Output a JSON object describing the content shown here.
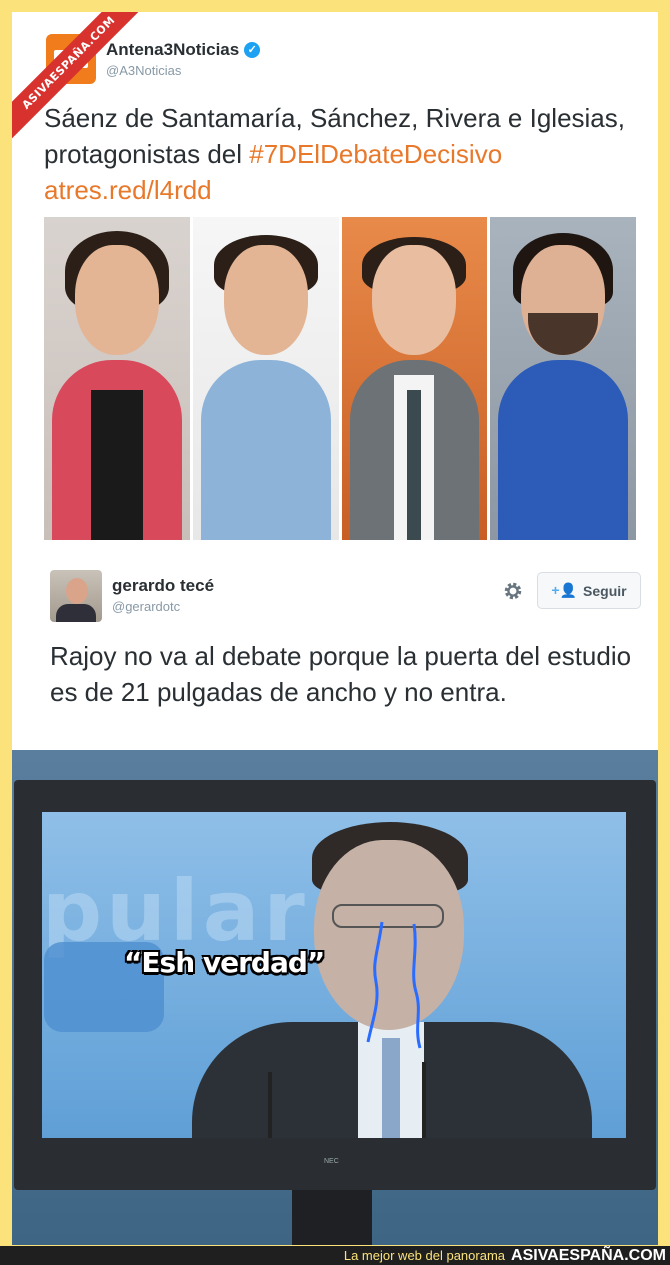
{
  "watermark": {
    "ribbon": "ASIVAESPAÑA.COM"
  },
  "tweet1": {
    "avatar_logo": "3n",
    "display_name": "Antena3Noticias",
    "handle": "@A3Noticias",
    "text_plain": "Sáenz de Santamaría, Sánchez, Rivera e Iglesias, protagonistas del",
    "hashtag": "#7DElDebateDecisivo",
    "link": "atres.red/l4rdd"
  },
  "tweet2": {
    "display_name": "gerardo tecé",
    "handle": "@gerardotc",
    "follow_label": "Seguir",
    "text": "Rajoy no va al debate porque la puerta del estudio es de 21 pulgadas de ancho y no entra."
  },
  "meme": {
    "caption": "“Esh verdad”",
    "screen_word": "pular",
    "monitor_brand": "NEC"
  },
  "footer": {
    "tagline": "La mejor web del panorama",
    "site": "ASIVAESPAÑA.COM"
  },
  "colors": {
    "background": "#fbe27a",
    "hashtag": "#e8782a",
    "verified": "#1da1f2",
    "ribbon": "#d8322f"
  }
}
